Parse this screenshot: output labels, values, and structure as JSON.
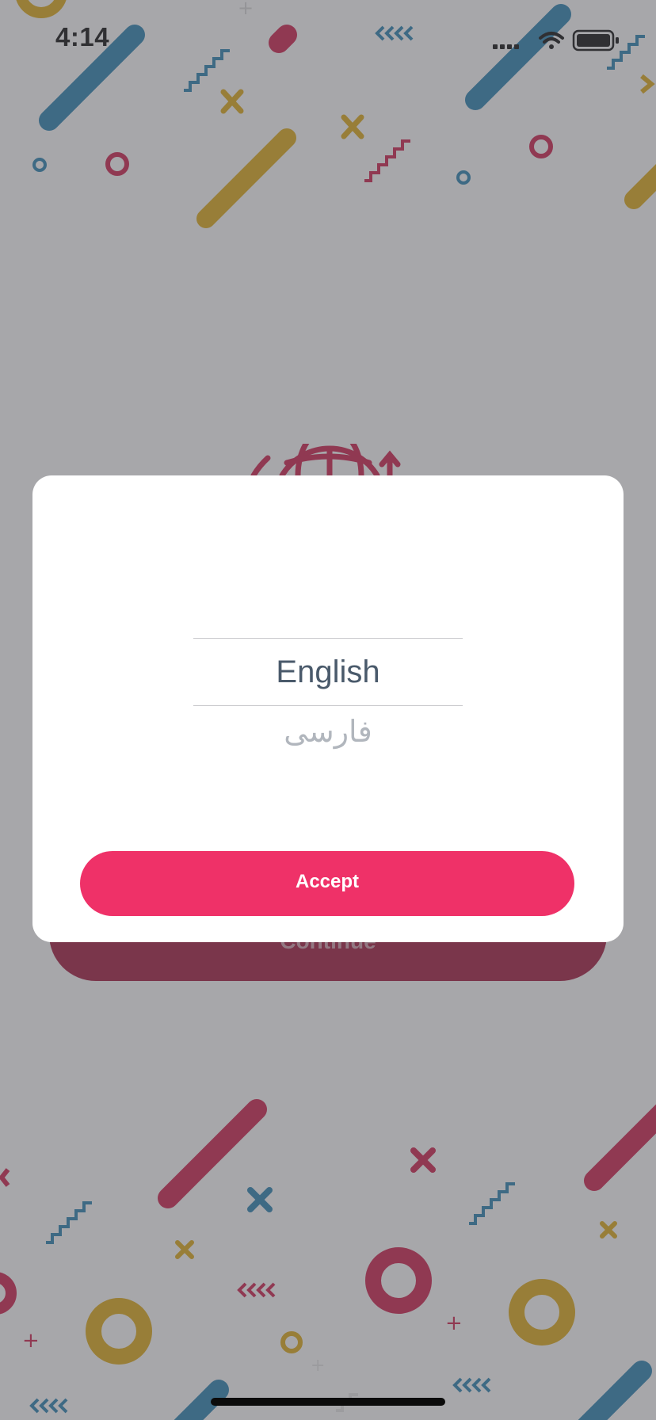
{
  "status_bar": {
    "time": "4:14",
    "icons": [
      "signal-icon",
      "wifi-icon",
      "battery-icon"
    ]
  },
  "background": {
    "pattern_colors": {
      "blue": "#2d84b3",
      "red": "#d0224f",
      "yellow": "#e0ac1b",
      "base": "#ffffff"
    },
    "continue_button_label": "Continue"
  },
  "dialog": {
    "language_options": [
      {
        "label": "English",
        "selected": true
      },
      {
        "label": "فارسی",
        "selected": false
      }
    ],
    "accept_label": "Accept"
  },
  "colors": {
    "accent": "#ef3168",
    "picker_text": "#4a5a6b",
    "picker_text_muted": "#b1b6bd"
  }
}
